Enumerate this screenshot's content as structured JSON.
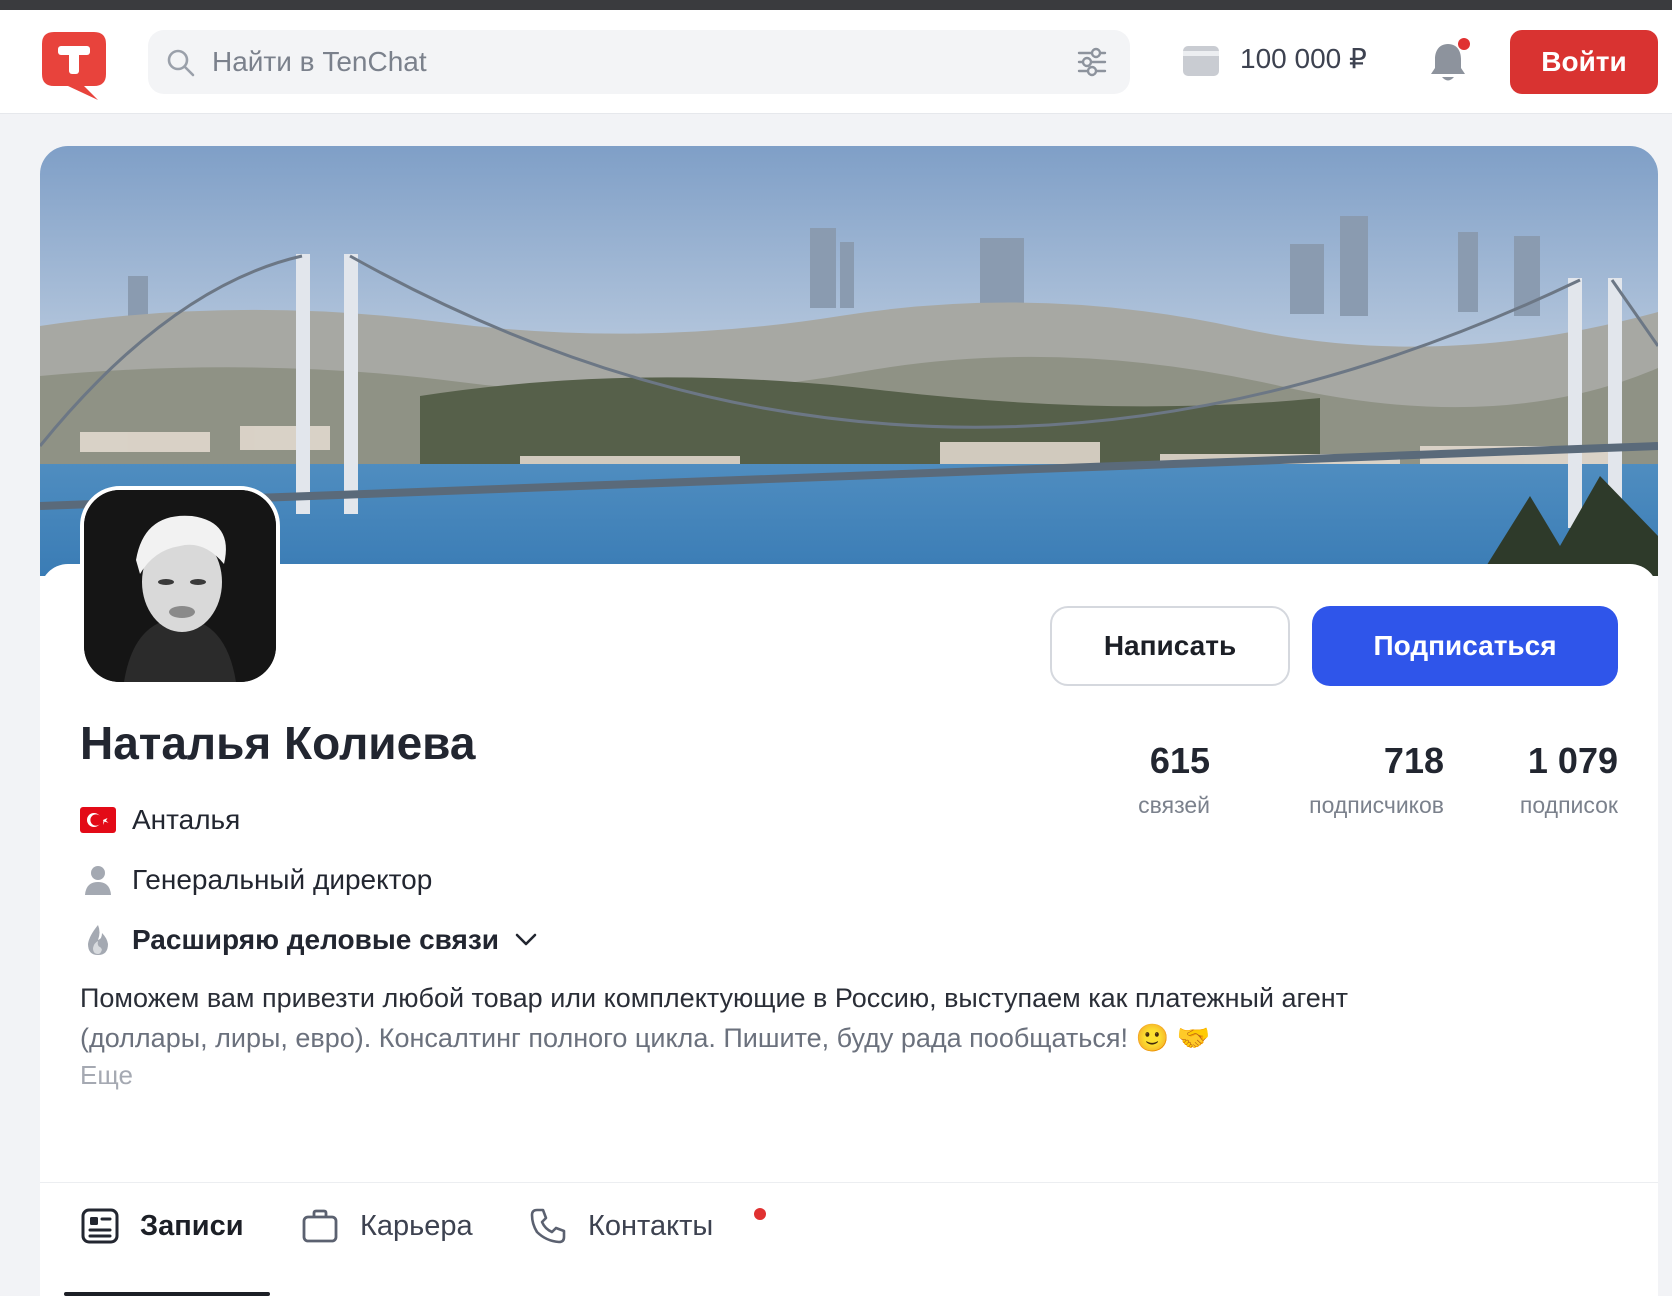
{
  "header": {
    "search_placeholder": "Найти в TenChat",
    "balance": "100 000 ₽",
    "login_label": "Войти",
    "icons": [
      "tenchat-logo-icon",
      "search-icon",
      "filter-icon",
      "wallet-icon",
      "bell-icon"
    ],
    "accent_color": "#d93331"
  },
  "profile": {
    "name": "Наталья Колиева",
    "write_label": "Написать",
    "subscribe_label": "Подписаться",
    "stats": [
      {
        "value": "615",
        "label": "связей"
      },
      {
        "value": "718",
        "label": "подписчиков"
      },
      {
        "value": "1 079",
        "label": "подписок"
      }
    ],
    "city": "Анталья",
    "position": "Генеральный директор",
    "goal": "Расширяю деловые связи",
    "bio_line1": "Поможем вам привезти любой товар или комплектующие в Россию, выступаем как платежный агент",
    "bio_line2": "(доллары, лиры, евро). Консалтинг полного цикла. Пишите, буду рада пообщаться! 🙂 🤝",
    "more_label": "Еще",
    "subscribe_color": "#2f55ea"
  },
  "tabs": [
    {
      "label": "Записи",
      "icon": "posts-icon",
      "active": true
    },
    {
      "label": "Карьера",
      "icon": "briefcase-icon",
      "active": false
    },
    {
      "label": "Контакты",
      "icon": "phone-icon",
      "active": false
    }
  ]
}
